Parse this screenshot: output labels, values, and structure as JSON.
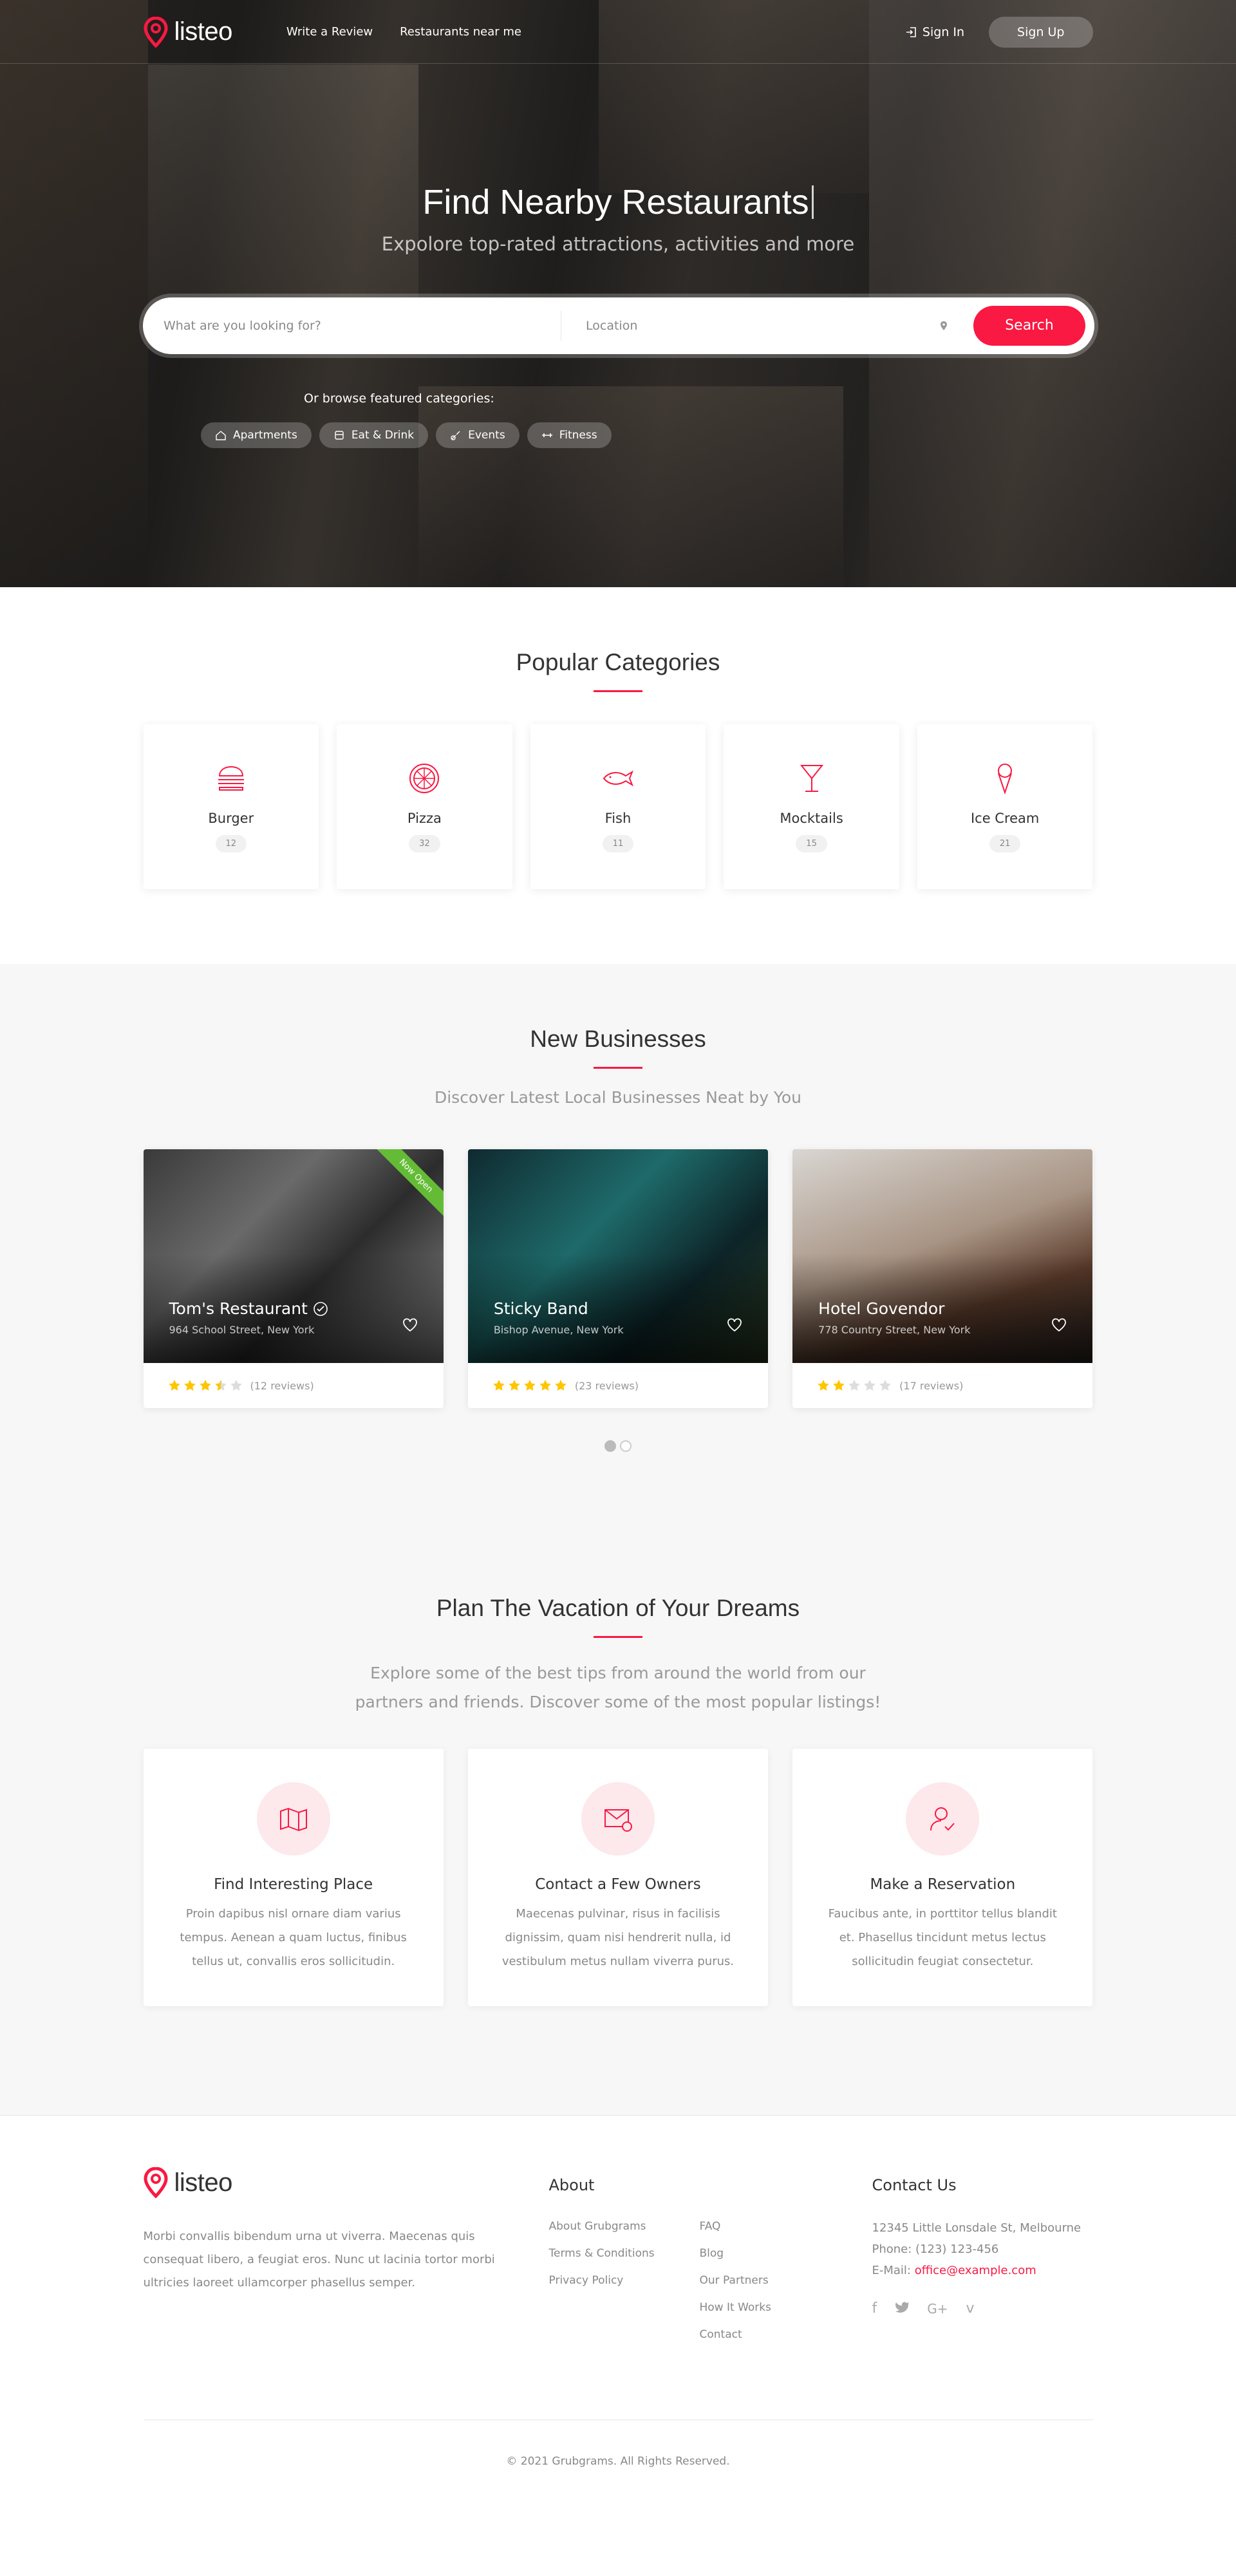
{
  "header": {
    "logo_text": "listeo",
    "nav": [
      "Write a Review",
      "Restaurants near me"
    ],
    "sign_in": "Sign In",
    "sign_up": "Sign Up"
  },
  "hero": {
    "title": "Find Nearby Restaurants",
    "subtitle": "Expolore top-rated attractions, activities and more",
    "search_placeholder": "What are you looking for?",
    "location_placeholder": "Location",
    "search_button": "Search",
    "browse_label": "Or browse featured categories:",
    "chips": [
      "Apartments",
      "Eat & Drink",
      "Events",
      "Fitness"
    ]
  },
  "categories": {
    "title": "Popular Categories",
    "items": [
      {
        "name": "Burger",
        "count": "12",
        "icon": "burger-icon"
      },
      {
        "name": "Pizza",
        "count": "32",
        "icon": "pizza-icon"
      },
      {
        "name": "Fish",
        "count": "11",
        "icon": "fish-icon"
      },
      {
        "name": "Mocktails",
        "count": "15",
        "icon": "cocktail-icon"
      },
      {
        "name": "Ice Cream",
        "count": "21",
        "icon": "ice-cream-icon"
      }
    ]
  },
  "businesses": {
    "title": "New Businesses",
    "subtitle": "Discover Latest Local Businesses Neat by You",
    "cards": [
      {
        "name": "Tom's Restaurant",
        "address": "964 School Street, New York",
        "reviews": "(12 reviews)",
        "rating": 3.5,
        "ribbon": "Now Open",
        "verified": true
      },
      {
        "name": "Sticky Band",
        "address": "Bishop Avenue, New York",
        "reviews": "(23 reviews)",
        "rating": 5
      },
      {
        "name": "Hotel Govendor",
        "address": "778 Country Street, New York",
        "reviews": "(17 reviews)",
        "rating": 2
      }
    ],
    "active_page": 1,
    "pages": 2
  },
  "vacation": {
    "title": "Plan The Vacation of Your Dreams",
    "subtitle_line1": "Explore some of the best tips from around the world from our",
    "subtitle_line2": "partners and friends. Discover some of the most popular listings!",
    "cards": [
      {
        "title": "Find Interesting Place",
        "text": "Proin dapibus nisl ornare diam varius tempus. Aenean a quam luctus, finibus tellus ut, convallis eros sollicitudin.",
        "icon": "map-icon"
      },
      {
        "title": "Contact a Few Owners",
        "text": "Maecenas pulvinar, risus in facilisis dignissim, quam nisi hendrerit nulla, id vestibulum metus nullam viverra purus.",
        "icon": "mail-icon"
      },
      {
        "title": "Make a Reservation",
        "text": "Faucibus ante, in porttitor tellus blandit et. Phasellus tincidunt metus lectus sollicitudin feugiat consectetur.",
        "icon": "user-check-icon"
      }
    ]
  },
  "footer": {
    "logo_text": "listeo",
    "about_text": "Morbi convallis bibendum urna ut viverra. Maecenas quis consequat libero, a feugiat eros. Nunc ut lacinia tortor morbi ultricies laoreet ullamcorper phasellus semper.",
    "about_title": "About",
    "links_col1": [
      "About Grubgrams",
      "Terms & Conditions",
      "Privacy Policy"
    ],
    "links_col2": [
      "FAQ",
      "Blog",
      "Our Partners",
      "How It Works",
      "Contact"
    ],
    "contact_title": "Contact Us",
    "address": "12345 Little Lonsdale St, Melbourne",
    "phone": "Phone: (123) 123-456",
    "email_label": "E-Mail: ",
    "email": "office@example.com",
    "socials": [
      "facebook-icon",
      "twitter-icon",
      "google-plus-icon",
      "vimeo-icon"
    ],
    "copyright": "© 2021 Grubgrams. All Rights Reserved."
  },
  "colors": {
    "accent": "#f91942",
    "ribbon": "#64bc36",
    "star": "#ffc600",
    "star_empty": "#dddddd"
  }
}
